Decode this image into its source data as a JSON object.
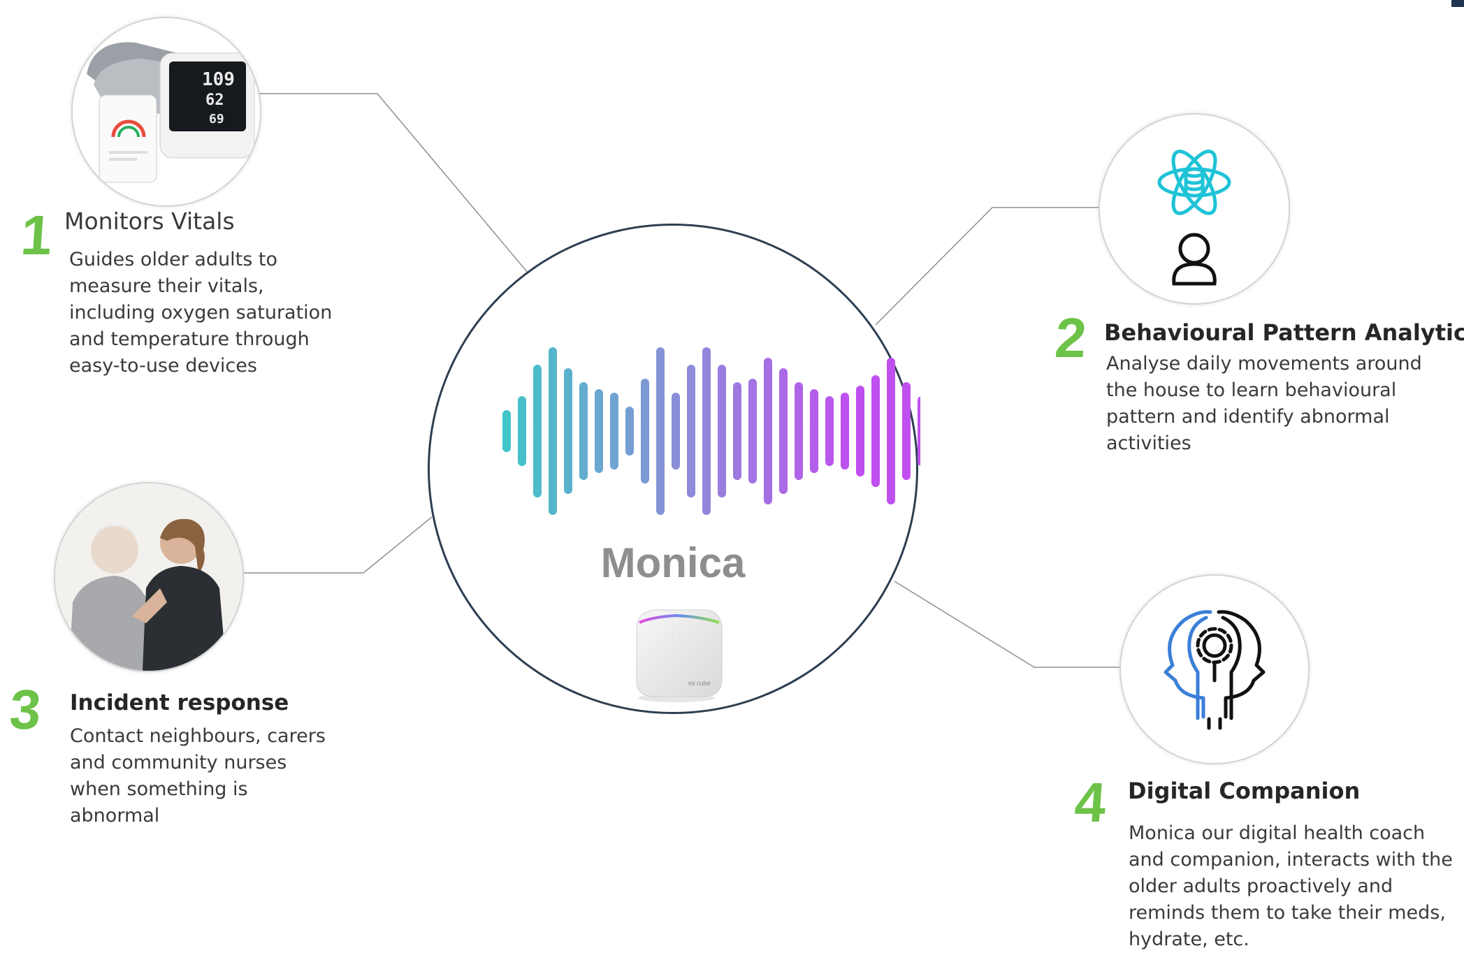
{
  "hub": {
    "name": "Monica",
    "device_label": "mi cube"
  },
  "features": [
    {
      "number": "1",
      "title": "Monitors Vitals",
      "description": "Guides older adults to measure their vitals, including oxygen saturation and temperature through easy-to-use devices",
      "icon": "blood-pressure-monitor-icon",
      "display_values": [
        "109",
        "62",
        "69"
      ]
    },
    {
      "number": "2",
      "title": "Behavioural Pattern Analytics",
      "description": "Analyse daily movements around the house to learn behavioural pattern and identify abnormal activities",
      "icon": "atom-database-person-icon"
    },
    {
      "number": "3",
      "title": "Incident response",
      "description": "Contact neighbours, carers and community nurses when something is abnormal",
      "icon": "carer-with-older-adult-photo"
    },
    {
      "number": "4",
      "title": "Digital Companion",
      "description": "Monica our digital health coach and companion, interacts with the older adults proactively and reminds them to take their meds, hydrate, etc.",
      "icon": "head-gear-ai-icon"
    }
  ],
  "colors": {
    "accent_green": "#6dc248",
    "hub_border": "#2d3e50",
    "wave_start": "#3ec7c7",
    "wave_mid": "#8a8fd8",
    "wave_end": "#c04ff0",
    "icon_cyan": "#1ec3d6",
    "icon_blue": "#3a7fd8"
  }
}
